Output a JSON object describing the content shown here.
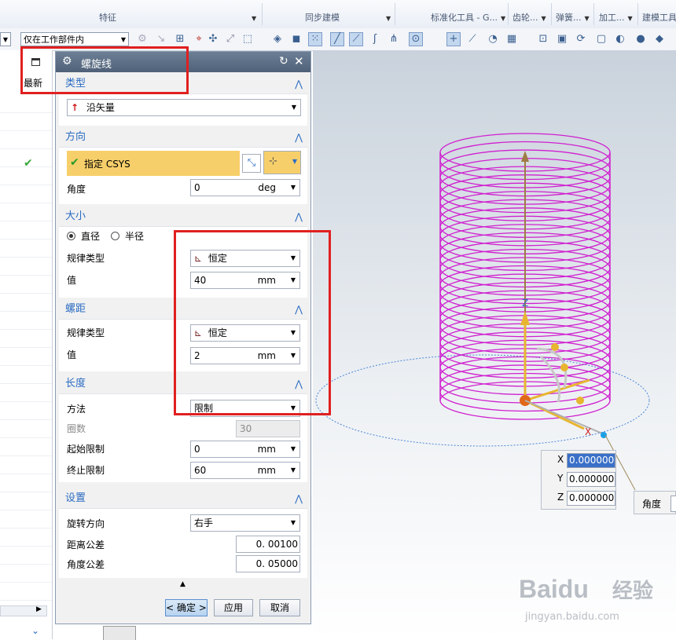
{
  "ribbon": {
    "groups": [
      {
        "label": "特征",
        "has_dropdown": true
      },
      {
        "label": "同步建模",
        "has_dropdown": true
      },
      {
        "label": "标准化工具 - G...",
        "has_dropdown": true
      },
      {
        "label": "齿轮...",
        "has_dropdown": true
      },
      {
        "label": "弹簧...",
        "has_dropdown": true
      },
      {
        "label": "加工...",
        "has_dropdown": true
      },
      {
        "label": "建模工具 - ...",
        "has_dropdown": true
      }
    ]
  },
  "toolbar": {
    "selection_scope": "仅在工作部件内"
  },
  "left_panel": {
    "column_header": "最新",
    "check_mark": "✔"
  },
  "dialog": {
    "title": "螺旋线",
    "type": {
      "header": "类型",
      "value": "沿矢量"
    },
    "direction": {
      "header": "方向",
      "specify_csys_label": "指定 CSYS",
      "angle_label": "角度",
      "angle_value": "0",
      "angle_unit": "deg"
    },
    "size": {
      "header": "大小",
      "radio_diameter": "直径",
      "radio_radius": "半径",
      "selected": "直径",
      "law_type_label": "规律类型",
      "law_type_value": "恒定",
      "value_label": "值",
      "value": "40",
      "unit": "mm"
    },
    "pitch": {
      "header": "螺距",
      "law_type_label": "规律类型",
      "law_type_value": "恒定",
      "value_label": "值",
      "value": "2",
      "unit": "mm"
    },
    "length": {
      "header": "长度",
      "method_label": "方法",
      "method_value": "限制",
      "turns_label": "圈数",
      "turns_value": "30",
      "start_label": "起始限制",
      "start_value": "0",
      "end_label": "终止限制",
      "end_value": "60",
      "unit": "mm"
    },
    "settings": {
      "header": "设置",
      "rotation_label": "旋转方向",
      "rotation_value": "右手",
      "dist_tol_label": "距离公差",
      "dist_tol_value": "0. 00100",
      "angle_tol_label": "角度公差",
      "angle_tol_value": "0. 05000"
    },
    "buttons": {
      "ok": "< 确定 >",
      "apply": "应用",
      "cancel": "取消"
    }
  },
  "viewport": {
    "axis_labels": {
      "z": "Z",
      "x": "X"
    },
    "coords": {
      "x_label": "X",
      "x_value": "0.0000000",
      "y_label": "Y",
      "y_value": "0.0000000",
      "z_label": "Z",
      "z_value": "0.0000000"
    },
    "angle_label": "角度",
    "helix_color": "#d020d0"
  },
  "watermark": {
    "brand": "Baidu",
    "brand_cn": "经验",
    "url": "jingyan.baidu.com"
  },
  "colors": {
    "highlight_box": "#e02020",
    "accent": "#2b6cc2",
    "specify_csys_bg": "#f7cf6a"
  }
}
